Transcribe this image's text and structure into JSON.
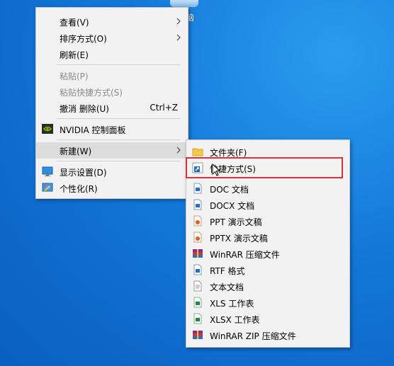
{
  "desktop": {
    "icon_label": "脑"
  },
  "context_menu": {
    "items": [
      {
        "label": "查看(V)",
        "submenu": true
      },
      {
        "label": "排序方式(O)",
        "submenu": true
      },
      {
        "label": "刷新(E)"
      },
      {
        "label": "粘贴(P)",
        "disabled": true
      },
      {
        "label": "粘贴快捷方式(S)",
        "disabled": true
      },
      {
        "label": "撤消 删除(U)",
        "shortcut": "Ctrl+Z"
      },
      {
        "label": "NVIDIA 控制面板",
        "icon": "nvidia-icon"
      },
      {
        "label": "新建(W)",
        "submenu": true,
        "selected": true
      },
      {
        "label": "显示设置(D)",
        "icon": "display-icon"
      },
      {
        "label": "个性化(R)",
        "icon": "personalize-icon"
      }
    ]
  },
  "new_submenu": {
    "items": [
      {
        "label": "文件夹(F)",
        "icon": "folder-icon"
      },
      {
        "label": "快捷方式(S)",
        "icon": "shortcut-icon",
        "highlighted": true
      },
      {
        "label": "DOC 文档",
        "icon": "word-doc-icon"
      },
      {
        "label": "DOCX 文档",
        "icon": "word-docx-icon"
      },
      {
        "label": "PPT 演示文稿",
        "icon": "ppt-icon"
      },
      {
        "label": "PPTX 演示文稿",
        "icon": "pptx-icon"
      },
      {
        "label": "WinRAR 压缩文件",
        "icon": "winrar-icon"
      },
      {
        "label": "RTF 格式",
        "icon": "rtf-icon"
      },
      {
        "label": "文本文档",
        "icon": "text-file-icon"
      },
      {
        "label": "XLS 工作表",
        "icon": "xls-icon"
      },
      {
        "label": "XLSX 工作表",
        "icon": "xlsx-icon"
      },
      {
        "label": "WinRAR ZIP 压缩文件",
        "icon": "winrar-zip-icon"
      }
    ]
  },
  "colors": {
    "highlight_border": "#d8323a",
    "menu_bg": "#f2f2f2",
    "selected_bg": "#dcdcdc",
    "desktop": "#1378d8"
  }
}
